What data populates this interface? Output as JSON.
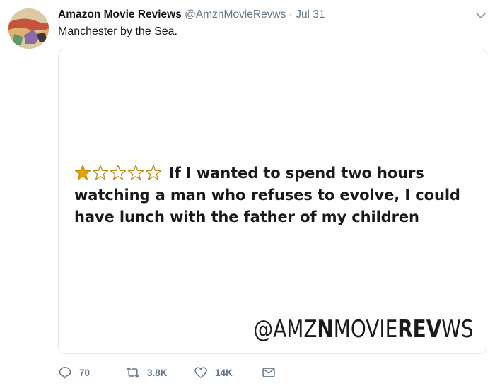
{
  "tweet": {
    "display_name": "Amazon Movie Reviews",
    "handle": "@AmznMovieRevws",
    "separator": "·",
    "date": "Jul 31",
    "text": "Manchester by the Sea."
  },
  "image": {
    "rating": 1,
    "rating_max": 5,
    "review_lines": [
      "If I wanted to spend two hours",
      "watching a man who refuses to evolve, I could",
      "have lunch with the father of my children"
    ],
    "watermark_parts": [
      "@AMZ",
      "N",
      "MOVIE",
      "REV",
      "WS"
    ]
  },
  "actions": {
    "replies": "70",
    "retweets": "3.8K",
    "likes": "14K"
  },
  "colors": {
    "action_gray": "#657786",
    "star_gold": "#e8a200",
    "text": "#14171a"
  },
  "icons": [
    "avatar",
    "chevron-down-icon",
    "star-icon",
    "reply-icon",
    "retweet-icon",
    "like-icon",
    "message-icon"
  ]
}
